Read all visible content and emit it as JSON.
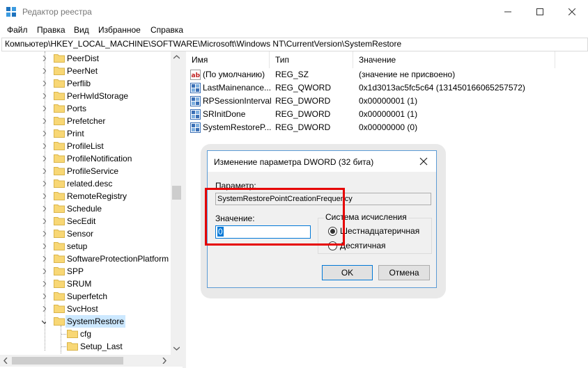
{
  "window": {
    "title": "Редактор реестра"
  },
  "menu": {
    "items": [
      "Файл",
      "Правка",
      "Вид",
      "Избранное",
      "Справка"
    ]
  },
  "address": {
    "path": "Компьютер\\HKEY_LOCAL_MACHINE\\SOFTWARE\\Microsoft\\Windows NT\\CurrentVersion\\SystemRestore"
  },
  "tree": {
    "items": [
      {
        "label": "PeerDist"
      },
      {
        "label": "PeerNet"
      },
      {
        "label": "Perflib"
      },
      {
        "label": "PerHwIdStorage"
      },
      {
        "label": "Ports"
      },
      {
        "label": "Prefetcher"
      },
      {
        "label": "Print"
      },
      {
        "label": "ProfileList"
      },
      {
        "label": "ProfileNotification"
      },
      {
        "label": "ProfileService"
      },
      {
        "label": "related.desc"
      },
      {
        "label": "RemoteRegistry"
      },
      {
        "label": "Schedule"
      },
      {
        "label": "SecEdit"
      },
      {
        "label": "Sensor"
      },
      {
        "label": "setup"
      },
      {
        "label": "SoftwareProtectionPlatform"
      },
      {
        "label": "SPP"
      },
      {
        "label": "SRUM"
      },
      {
        "label": "Superfetch"
      },
      {
        "label": "SvcHost"
      },
      {
        "label": "SystemRestore"
      },
      {
        "label": "cfg"
      },
      {
        "label": "Setup_Last"
      }
    ],
    "selected": "SystemRestore"
  },
  "values": {
    "columns": [
      "Имя",
      "Тип",
      "Значение"
    ],
    "rows": [
      {
        "icon": "string-value-icon",
        "name": "(По умолчанию)",
        "type": "REG_SZ",
        "data": "(значение не присвоено)"
      },
      {
        "icon": "binary-value-icon",
        "name": "LastMainenance...",
        "type": "REG_QWORD",
        "data": "0x1d3013ac5fc5c64 (131450166065257572)"
      },
      {
        "icon": "binary-value-icon",
        "name": "RPSessionInterval",
        "type": "REG_DWORD",
        "data": "0x00000001 (1)"
      },
      {
        "icon": "binary-value-icon",
        "name": "SRInitDone",
        "type": "REG_DWORD",
        "data": "0x00000001 (1)"
      },
      {
        "icon": "binary-value-icon",
        "name": "SystemRestoreP...",
        "type": "REG_DWORD",
        "data": "0x00000000 (0)"
      }
    ]
  },
  "dialog": {
    "title": "Изменение параметра DWORD (32 бита)",
    "param_label": "Параметр:",
    "param_value": "SystemRestorePointCreationFrequency",
    "value_label": "Значение:",
    "value": "0",
    "radix_group": "Система исчисления",
    "radix_options": [
      "Шестнадцатеричная",
      "Десятичная"
    ],
    "radix_selected": "Шестнадцатеричная",
    "ok_label": "OK",
    "cancel_label": "Отмена"
  },
  "colors": {
    "selection": "#cce8ff",
    "highlight_box": "#e60000",
    "dialog_border": "#5b9bd5",
    "folder": "#f8d775"
  }
}
